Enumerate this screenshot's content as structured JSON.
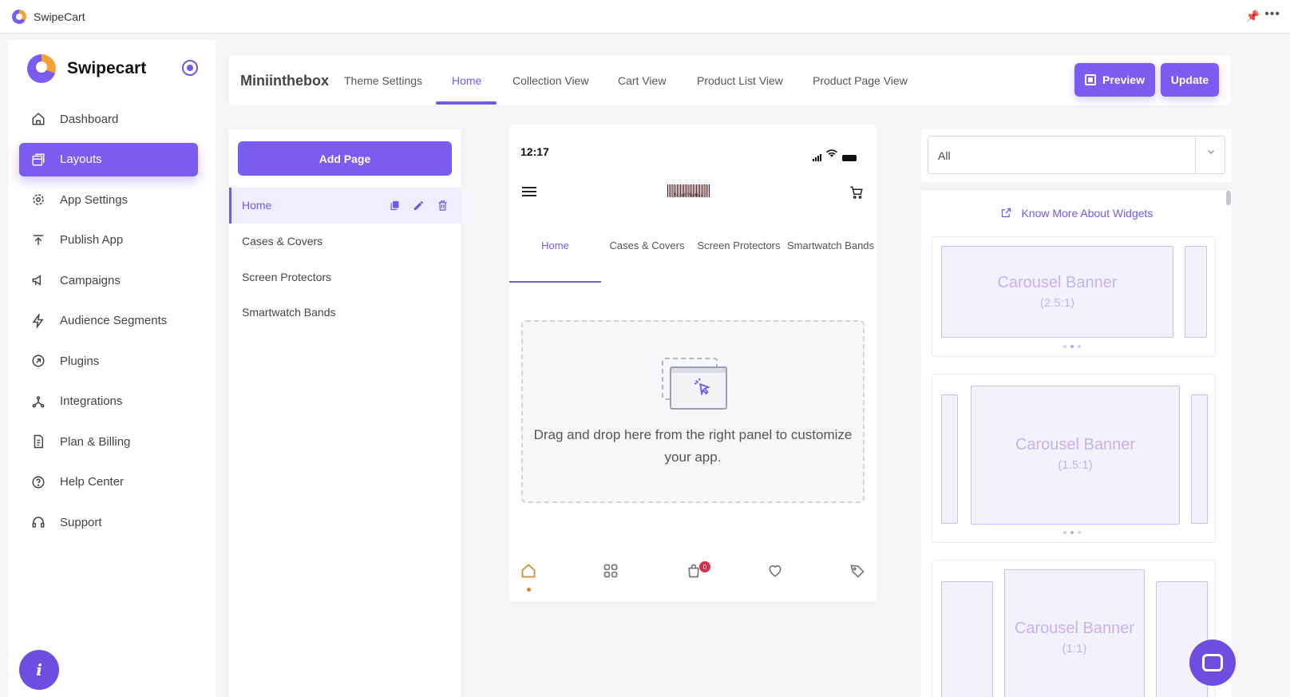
{
  "window": {
    "title": "SwipeCart"
  },
  "sidebar": {
    "brand": "Swipecart",
    "items": [
      {
        "label": "Dashboard",
        "icon": "home-icon",
        "active": false
      },
      {
        "label": "Layouts",
        "icon": "layouts-icon",
        "active": true
      },
      {
        "label": "App Settings",
        "icon": "gear-icon",
        "active": false
      },
      {
        "label": "Publish App",
        "icon": "publish-icon",
        "active": false
      },
      {
        "label": "Campaigns",
        "icon": "megaphone-icon",
        "active": false
      },
      {
        "label": "Audience Segments",
        "icon": "bolt-icon",
        "active": false
      },
      {
        "label": "Plugins",
        "icon": "plugin-icon",
        "active": false
      },
      {
        "label": "Integrations",
        "icon": "integrations-icon",
        "active": false
      },
      {
        "label": "Plan & Billing",
        "icon": "billing-icon",
        "active": false
      },
      {
        "label": "Help Center",
        "icon": "help-icon",
        "active": false
      },
      {
        "label": "Support",
        "icon": "support-icon",
        "active": false
      }
    ],
    "info_label": "i"
  },
  "topnav": {
    "store_name": "Miniinthebox",
    "tabs": [
      {
        "label": "Theme Settings",
        "active": false
      },
      {
        "label": "Home",
        "active": true
      },
      {
        "label": "Collection View",
        "active": false
      },
      {
        "label": "Cart View",
        "active": false
      },
      {
        "label": "Product List View",
        "active": false
      },
      {
        "label": "Product Page View",
        "active": false
      }
    ],
    "preview_label": "Preview",
    "update_label": "Update"
  },
  "pages": {
    "add_label": "Add Page",
    "items": [
      {
        "label": "Home",
        "active": true
      },
      {
        "label": "Cases & Covers",
        "active": false
      },
      {
        "label": "Screen Protectors",
        "active": false
      },
      {
        "label": "Smartwatch Bands",
        "active": false
      }
    ]
  },
  "phone": {
    "time": "12:17",
    "logo_text": "MiniInTheBox",
    "tabs": [
      {
        "label": "Home",
        "active": true
      },
      {
        "label": "Cases & Covers",
        "active": false
      },
      {
        "label": "Screen Protectors",
        "active": false
      },
      {
        "label": "Smartwatch Bands",
        "active": false
      }
    ],
    "drop_text": "Drag and drop here from the right panel to customize your app.",
    "cart_badge": "0"
  },
  "widgets": {
    "filter_value": "All",
    "know_more": "Know More About Widgets",
    "cards": [
      {
        "title": "Carousel Banner",
        "ratio": "(2.5:1)"
      },
      {
        "title": "Carousel Banner",
        "ratio": "(1.5:1)"
      },
      {
        "title": "Carousel Banner",
        "ratio": "(1:1)"
      }
    ]
  },
  "colors": {
    "accent": "#7b5cf0",
    "accent_text": "#6c5ce7",
    "home_icon": "#d38a2a",
    "badge": "#d62f4a"
  }
}
